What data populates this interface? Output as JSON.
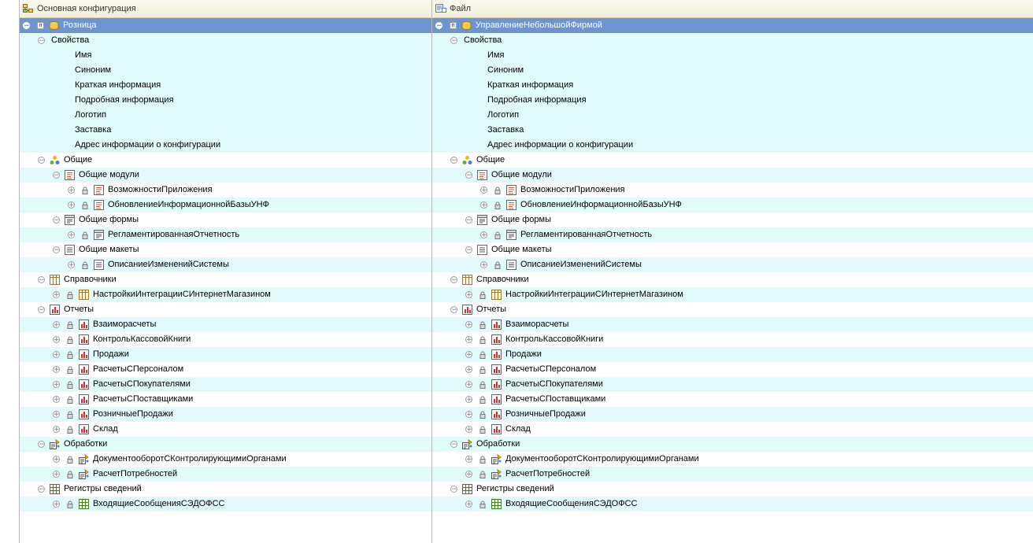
{
  "headers": {
    "left": "Основная конфигурация",
    "right": "Файл"
  },
  "rows": [
    {
      "level": 0,
      "exp": "minus",
      "ind": "п",
      "lock": false,
      "icon": "config-icon",
      "left": "Розница",
      "right": "УправлениеНебольшойФирмой",
      "sel": true
    },
    {
      "level": 1,
      "exp": "minus",
      "lock": false,
      "icon": "",
      "left": "Свойства",
      "right": "Свойства"
    },
    {
      "level": 3,
      "exp": "",
      "lock": false,
      "icon": "",
      "left": "Имя",
      "right": "Имя"
    },
    {
      "level": 3,
      "exp": "",
      "lock": false,
      "icon": "",
      "left": "Синоним",
      "right": "Синоним"
    },
    {
      "level": 3,
      "exp": "",
      "lock": false,
      "icon": "",
      "left": "Краткая информация",
      "right": "Краткая информация"
    },
    {
      "level": 3,
      "exp": "",
      "lock": false,
      "icon": "",
      "left": "Подробная информация",
      "right": "Подробная информация"
    },
    {
      "level": 3,
      "exp": "",
      "lock": false,
      "icon": "",
      "left": "Логотип",
      "right": "Логотип"
    },
    {
      "level": 3,
      "exp": "",
      "lock": false,
      "icon": "",
      "left": "Заставка",
      "right": "Заставка"
    },
    {
      "level": 3,
      "exp": "",
      "lock": false,
      "icon": "",
      "left": "Адрес информации о конфигурации",
      "right": "Адрес информации о конфигурации"
    },
    {
      "level": 1,
      "exp": "minus",
      "lock": false,
      "icon": "common-icon",
      "left": "Общие",
      "right": "Общие"
    },
    {
      "level": 2,
      "exp": "minus",
      "lock": false,
      "icon": "module-icon",
      "left": "Общие модули",
      "right": "Общие модули"
    },
    {
      "level": 3,
      "exp": "plus",
      "lock": true,
      "icon": "module-icon",
      "left": "ВозможностиПриложения",
      "right": "ВозможностиПриложения"
    },
    {
      "level": 3,
      "exp": "plus",
      "lock": true,
      "icon": "module-icon",
      "left": "ОбновлениеИнформационнойБазыУНФ",
      "right": "ОбновлениеИнформационнойБазыУНФ"
    },
    {
      "level": 2,
      "exp": "minus",
      "lock": false,
      "icon": "form-icon",
      "left": "Общие формы",
      "right": "Общие формы"
    },
    {
      "level": 3,
      "exp": "plus",
      "lock": true,
      "icon": "form-icon",
      "left": "РегламентированнаяОтчетность",
      "right": "РегламентированнаяОтчетность"
    },
    {
      "level": 2,
      "exp": "minus",
      "lock": false,
      "icon": "template-icon",
      "left": "Общие макеты",
      "right": "Общие макеты"
    },
    {
      "level": 3,
      "exp": "plus",
      "lock": true,
      "icon": "template-icon",
      "left": "ОписаниеИзмененийСистемы",
      "right": "ОписаниеИзмененийСистемы"
    },
    {
      "level": 1,
      "exp": "minus",
      "lock": false,
      "icon": "catalog-icon",
      "left": "Справочники",
      "right": "Справочники"
    },
    {
      "level": 2,
      "exp": "plus",
      "lock": true,
      "icon": "catalog-icon",
      "left": "НастройкиИнтеграцииСИнтернетМагазином",
      "right": "НастройкиИнтеграцииСИнтернетМагазином"
    },
    {
      "level": 1,
      "exp": "minus",
      "lock": false,
      "icon": "report-icon",
      "left": "Отчеты",
      "right": "Отчеты"
    },
    {
      "level": 2,
      "exp": "plus",
      "lock": true,
      "icon": "report-icon",
      "left": "Взаиморасчеты",
      "right": "Взаиморасчеты"
    },
    {
      "level": 2,
      "exp": "plus",
      "lock": true,
      "icon": "report-icon",
      "left": "КонтрольКассовойКниги",
      "right": "КонтрольКассовойКниги"
    },
    {
      "level": 2,
      "exp": "plus",
      "lock": true,
      "icon": "report-icon",
      "left": "Продажи",
      "right": "Продажи"
    },
    {
      "level": 2,
      "exp": "plus",
      "lock": true,
      "icon": "report-icon",
      "left": "РасчетыСПерсоналом",
      "right": "РасчетыСПерсоналом"
    },
    {
      "level": 2,
      "exp": "plus",
      "lock": true,
      "icon": "report-icon",
      "left": "РасчетыСПокупателями",
      "right": "РасчетыСПокупателями"
    },
    {
      "level": 2,
      "exp": "plus",
      "lock": true,
      "icon": "report-icon",
      "left": "РасчетыСПоставщиками",
      "right": "РасчетыСПоставщиками"
    },
    {
      "level": 2,
      "exp": "plus",
      "lock": true,
      "icon": "report-icon",
      "left": "РозничныеПродажи",
      "right": "РозничныеПродажи"
    },
    {
      "level": 2,
      "exp": "plus",
      "lock": true,
      "icon": "report-icon",
      "left": "Склад",
      "right": "Склад"
    },
    {
      "level": 1,
      "exp": "minus",
      "lock": false,
      "icon": "processing-icon",
      "left": "Обработки",
      "right": "Обработки"
    },
    {
      "level": 2,
      "exp": "plus",
      "lock": true,
      "icon": "processing-icon",
      "left": "ДокументооборотСКонтролирующимиОрганами",
      "right": "ДокументооборотСКонтролирующимиОрганами"
    },
    {
      "level": 2,
      "exp": "plus",
      "lock": true,
      "icon": "processing-icon",
      "left": "РасчетПотребностей",
      "right": "РасчетПотребностей"
    },
    {
      "level": 1,
      "exp": "minus",
      "lock": false,
      "icon": "register-icon",
      "left": "Регистры сведений",
      "right": "Регистры сведений"
    },
    {
      "level": 2,
      "exp": "plus",
      "lock": true,
      "icon": "register-icon",
      "left": "ВходящиеСообщенияСЭДОФСС",
      "right": "ВходящиеСообщенияСЭДОФСС"
    }
  ],
  "colors": {
    "selected": "#6e94d0",
    "alt_row": "#e1fafb",
    "header_bg": "#f6f4e2"
  }
}
